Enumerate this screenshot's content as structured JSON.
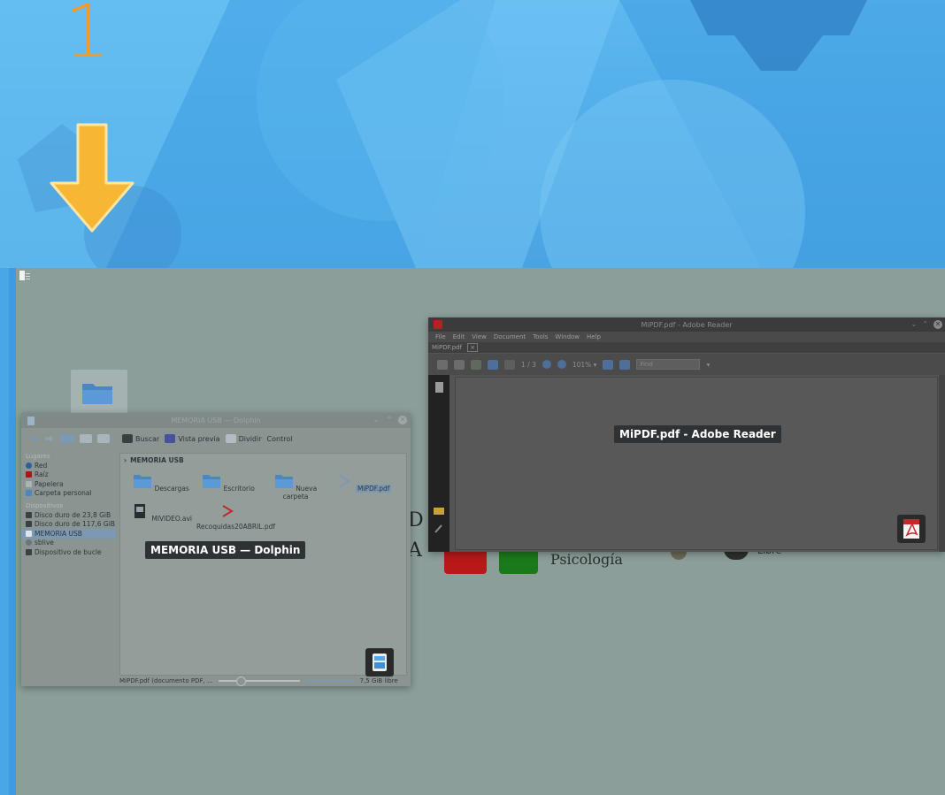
{
  "annotation": {
    "step_number": "1",
    "step_color": "#f39a2a",
    "arrow_color": "#f7b634"
  },
  "desktop": {
    "background_logo": {
      "letter_d": "D",
      "letter_a": "A",
      "psicologia": "Psicología",
      "libre": "Libre"
    }
  },
  "windows": {
    "dolphin": {
      "title": "MEMORIA USB — Dolphin",
      "caption": "MEMORIA USB — Dolphin",
      "toolbar": {
        "search_label": "Buscar",
        "preview_label": "Vista previa",
        "split_label": "Dividir",
        "control_label": "Control"
      },
      "sidebar": {
        "places_heading": "Lugares",
        "places": [
          "Red",
          "Raíz",
          "Papelera",
          "Carpeta personal"
        ],
        "devices_heading": "Dispositivos",
        "devices": [
          "Disco duro de 23,8 GiB",
          "Disco duro de 117,6 GiB",
          "MEMORIA USB",
          "sblive",
          "Dispositivo de bucle"
        ]
      },
      "breadcrumb": "MEMORIA USB",
      "files": [
        {
          "name": "Descargas",
          "icon": "folder-icon"
        },
        {
          "name": "Escritorio",
          "icon": "folder-icon"
        },
        {
          "name": "Nueva carpeta",
          "icon": "folder-icon"
        },
        {
          "name": "MiPDF.pdf",
          "icon": "pdf-icon"
        },
        {
          "name": "MIVIDEO.avi",
          "icon": "video-icon"
        },
        {
          "name": "Recoquidas20ABRIL.pdf",
          "icon": "pdf-icon"
        }
      ],
      "status_text": "MiPDF.pdf (documento PDF, ...",
      "free_space": "7,5 GiB libre"
    },
    "adobe_reader": {
      "title": "MiPDF.pdf - Adobe Reader",
      "caption": "MiPDF.pdf - Adobe Reader",
      "menu": [
        "File",
        "Edit",
        "View",
        "Document",
        "Tools",
        "Window",
        "Help"
      ],
      "tab": "MiPDF.pdf",
      "page_counter": "1 / 3",
      "zoom": "101% ▾",
      "find_placeholder": "Find"
    }
  }
}
